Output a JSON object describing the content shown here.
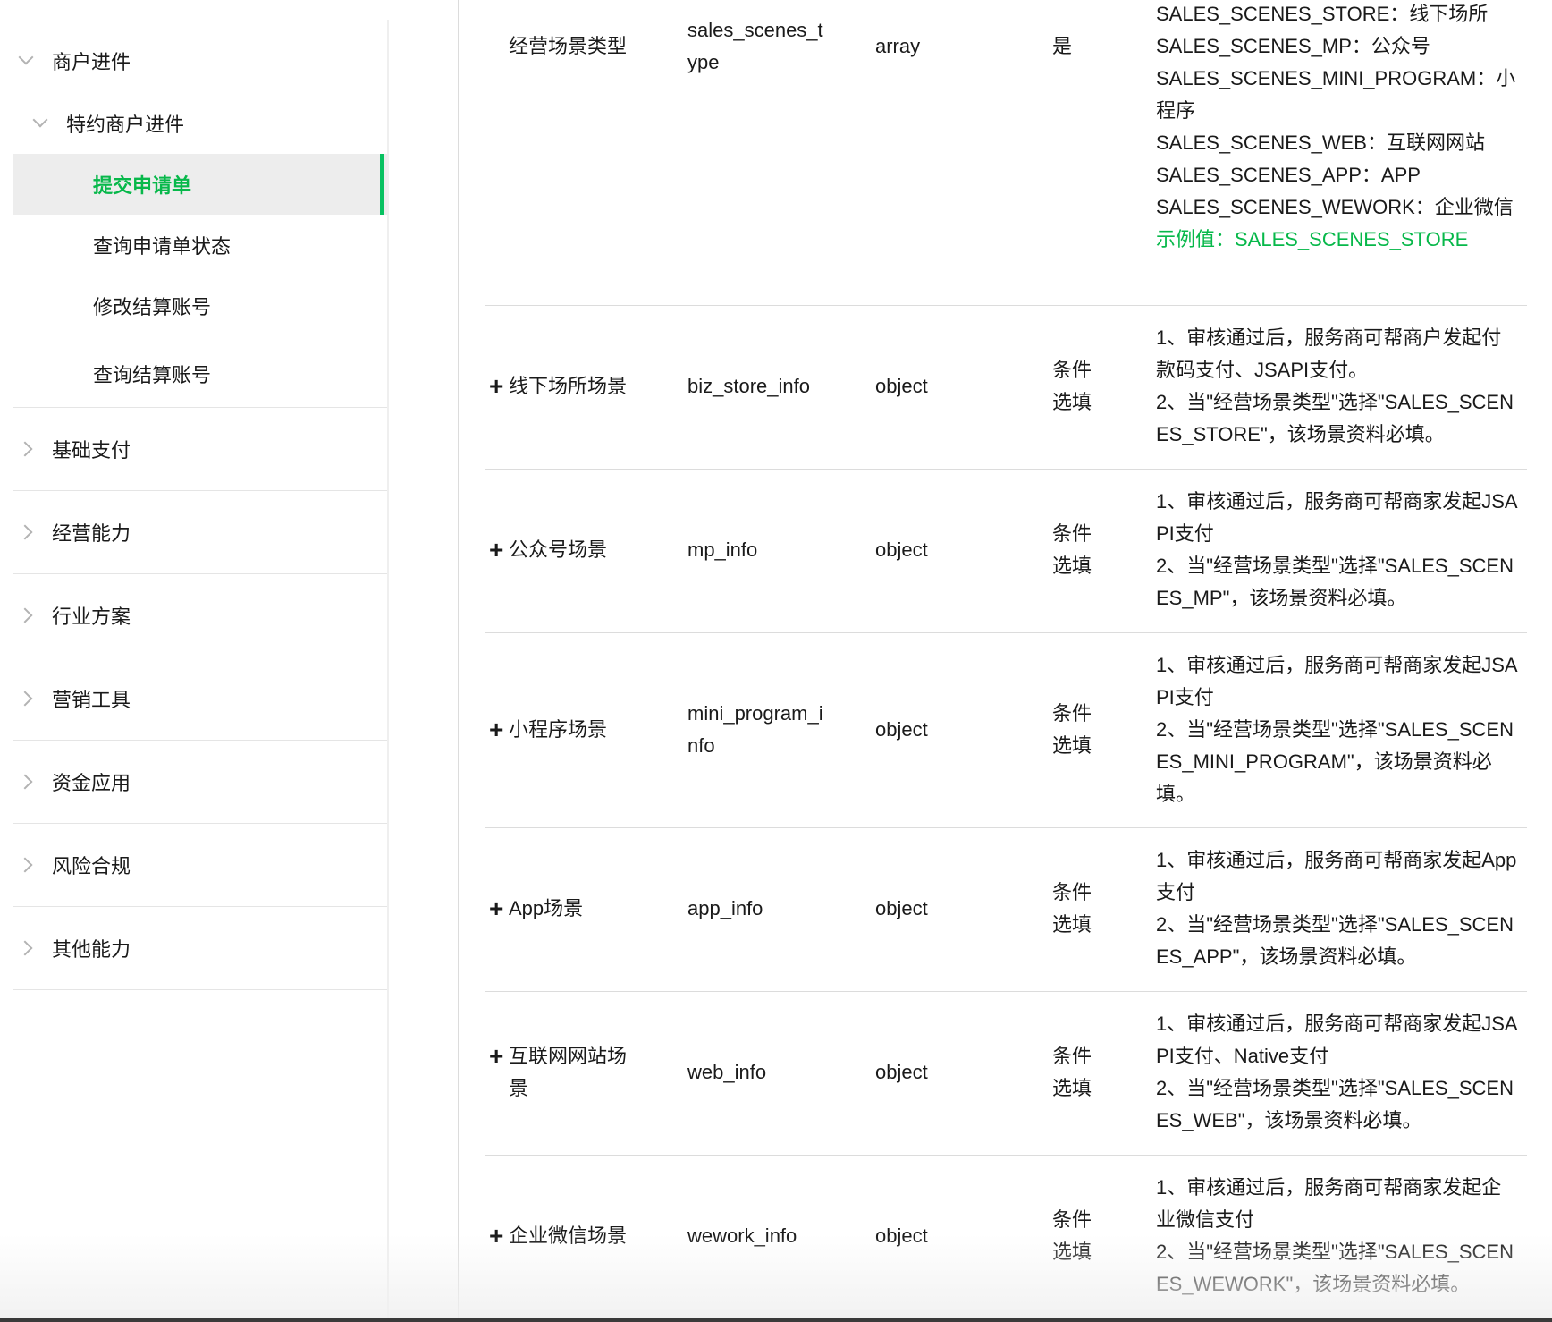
{
  "sidebar": {
    "section_title": "商户进件",
    "subsection_title": "特约商户进件",
    "items": [
      {
        "label": "提交申请单",
        "active": true
      },
      {
        "label": "查询申请单状态"
      },
      {
        "label": "修改结算账号"
      },
      {
        "label": "查询结算账号"
      }
    ],
    "groups": [
      {
        "label": "基础支付"
      },
      {
        "label": "经营能力"
      },
      {
        "label": "行业方案"
      },
      {
        "label": "营销工具"
      },
      {
        "label": "资金应用"
      },
      {
        "label": "风险合规"
      },
      {
        "label": "其他能力"
      }
    ]
  },
  "table": {
    "rows": [
      {
        "name": "经营场景类型",
        "expandable": false,
        "field": "sales_scenes_type",
        "type": "array",
        "required": "是",
        "desc": [
          "SALES_SCENES_STORE：线下场所",
          "SALES_SCENES_MP：公众号",
          "SALES_SCENES_MINI_PROGRAM：小程序",
          "SALES_SCENES_WEB：互联网网站",
          "SALES_SCENES_APP：APP",
          "SALES_SCENES_WEWORK：企业微信"
        ],
        "example": "示例值：SALES_SCENES_STORE"
      },
      {
        "name": "线下场所场景",
        "expandable": true,
        "field": "biz_store_info",
        "type": "object",
        "required": "条件选填",
        "desc": [
          "1、审核通过后，服务商可帮商户发起付款码支付、JSAPI支付。",
          "2、当\"经营场景类型\"选择\"SALES_SCENES_STORE\"，该场景资料必填。"
        ]
      },
      {
        "name": "公众号场景",
        "expandable": true,
        "field": "mp_info",
        "type": "object",
        "required": "条件选填",
        "desc": [
          "1、审核通过后，服务商可帮商家发起JSAPI支付",
          "2、当\"经营场景类型\"选择\"SALES_SCENES_MP\"，该场景资料必填。"
        ]
      },
      {
        "name": "小程序场景",
        "expandable": true,
        "field": "mini_program_info",
        "type": "object",
        "required": "条件选填",
        "desc": [
          "1、审核通过后，服务商可帮商家发起JSAPI支付",
          "2、当\"经营场景类型\"选择\"SALES_SCENES_MINI_PROGRAM\"，该场景资料必填。"
        ]
      },
      {
        "name": "App场景",
        "expandable": true,
        "field": "app_info",
        "type": "object",
        "required": "条件选填",
        "desc": [
          "1、审核通过后，服务商可帮商家发起App支付",
          "2、当\"经营场景类型\"选择\"SALES_SCENES_APP\"，该场景资料必填。"
        ]
      },
      {
        "name": "互联网网站场景",
        "expandable": true,
        "field": "web_info",
        "type": "object",
        "required": "条件选填",
        "desc": [
          "1、审核通过后，服务商可帮商家发起JSAPI支付、Native支付",
          "2、当\"经营场景类型\"选择\"SALES_SCENES_WEB\"，该场景资料必填。"
        ]
      },
      {
        "name": "企业微信场景",
        "expandable": true,
        "field": "wework_info",
        "type": "object",
        "required": "条件选填",
        "desc": [
          "1、审核通过后，服务商可帮商家发起企业微信支付",
          "2、当\"经营场景类型\"选择\"SALES_SCENES_WEWORK\"，该场景资料必填。"
        ]
      }
    ]
  },
  "colors": {
    "accent": "#07c160",
    "active_text": "#07b84a",
    "active_bg": "#ededed"
  }
}
